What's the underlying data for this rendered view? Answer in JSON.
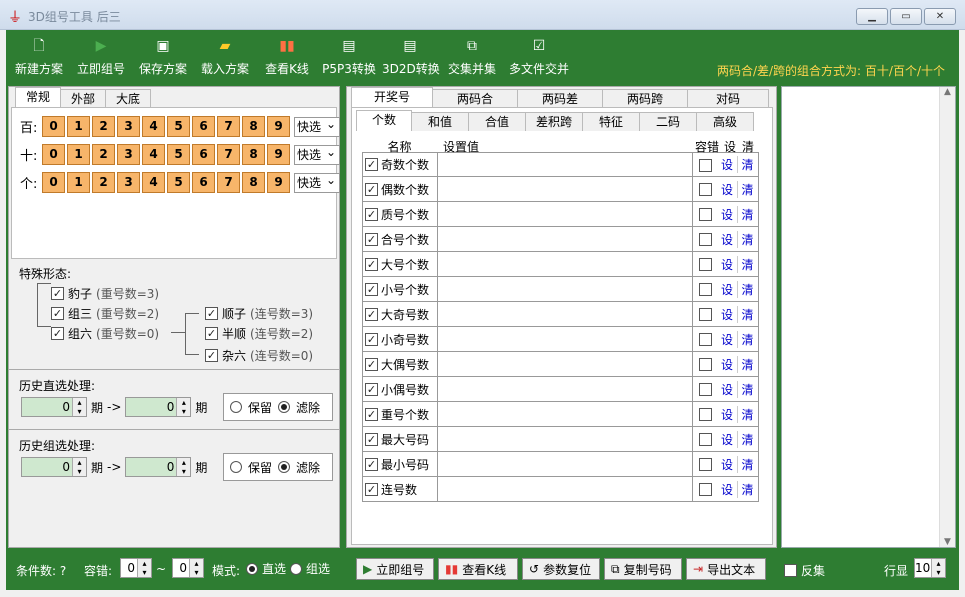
{
  "window": {
    "title": "3D组号工具 后三",
    "min": "▁",
    "max": "▭",
    "close": "✕"
  },
  "toolbar": {
    "new": "新建方案",
    "build": "立即组号",
    "save": "保存方案",
    "load": "载入方案",
    "view_k": "查看K线",
    "p5p3": "P5P3转换",
    "d3d2": "3D2D转换",
    "intersect": "交集并集",
    "multi": "多文件交并"
  },
  "combo_info": "两码合/差/跨的组合方式为: 百十/百个/十个",
  "left_tabs": [
    "常规",
    "外部",
    "大底"
  ],
  "digits": {
    "rows": [
      {
        "label": "百:"
      },
      {
        "label": "十:"
      },
      {
        "label": "个:"
      }
    ],
    "values": [
      "0",
      "1",
      "2",
      "3",
      "4",
      "5",
      "6",
      "7",
      "8",
      "9"
    ],
    "quick": "快选"
  },
  "special": {
    "title": "特殊形态:",
    "baozi": "豹子",
    "baozi_note": "(重号数=3)",
    "zusan": "组三",
    "zusan_note": "(重号数=2)",
    "zuliu": "组六",
    "zuliu_note": "(重号数=0)",
    "shunzi": "顺子",
    "shunzi_note": "(连号数=3)",
    "banshun": "半顺",
    "banshun_note": "(连号数=2)",
    "zaliu": "杂六",
    "zaliu_note": "(连号数=0)"
  },
  "hist_direct": {
    "title": "历史直选处理:",
    "from": "0",
    "to": "0",
    "unit": "期",
    "arrow": "->",
    "keep": "保留",
    "filter": "滤除"
  },
  "hist_group": {
    "title": "历史组选处理:",
    "from": "0",
    "to": "0",
    "unit": "期",
    "arrow": "->",
    "keep": "保留",
    "filter": "滤除"
  },
  "main_tabs": [
    "开奖号",
    "两码合",
    "两码差",
    "两码跨",
    "对码"
  ],
  "sub_tabs": [
    "个数",
    "和值",
    "合值",
    "差积跨",
    "特征",
    "二码",
    "高级"
  ],
  "grid": {
    "h_name": "名称",
    "h_value": "设置值",
    "h_tol": "容错",
    "h_set": "设",
    "h_clr": "清",
    "set": "设",
    "clr": "清",
    "rows": [
      "奇数个数",
      "偶数个数",
      "质号个数",
      "合号个数",
      "大号个数",
      "小号个数",
      "大奇号数",
      "小奇号数",
      "大偶号数",
      "小偶号数",
      "重号个数",
      "最大号码",
      "最小号码",
      "连号数"
    ]
  },
  "status": {
    "cond": "条件数: ?",
    "tol": "容错:",
    "tol_a": "0",
    "tilde": "~",
    "tol_b": "0",
    "mode": "模式:",
    "direct": "直选",
    "group": "组选",
    "btn_build": "立即组号",
    "btn_k": "查看K线",
    "btn_reset": "参数复位",
    "btn_copy": "复制号码",
    "btn_export": "导出文本",
    "reverse": "反集",
    "rows_label": "行显",
    "rows_val": "10"
  }
}
